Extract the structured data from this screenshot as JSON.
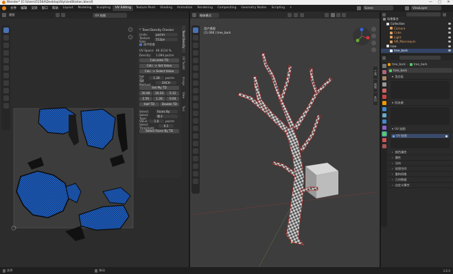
{
  "window": {
    "title": "Blender* [C:\\Users\\51564\\Desktop\\StylizedStation.blend]",
    "minimize": "—",
    "maximize": "□",
    "close": "✕"
  },
  "menu": [
    "文件",
    "编辑",
    "渲染",
    "窗口",
    "帮助"
  ],
  "workspace_tabs": [
    "Layout",
    "Modeling",
    "Sculpting",
    "UV Editing",
    "Texture Paint",
    "Shading",
    "Animation",
    "Rendering",
    "Compositing",
    "Geometry Nodes",
    "Scripting"
  ],
  "active_workspace": "UV Editing",
  "scene": "Scene",
  "view_layer": "ViewLayer",
  "uv_editor": {
    "header_mode": "视图",
    "image_label": "UV 贴图",
    "texel_panel": {
      "title": "Texel Density Checker",
      "units_label": "Units:",
      "units_value": "px/cm",
      "texture_size_label": "Texture Size:",
      "texture_size_value": "512px",
      "checkbox_label": "选中检查",
      "uv_space_label": "UV Space:",
      "uv_space_value": "46.3114 %",
      "density_label": "Density:",
      "density_value": "1.094 px/cm",
      "btn_calculate": "Calculate TD",
      "btn_calc_uv": "Calc -> Set Value",
      "btn_calc_select": "Calc -> Select Value",
      "set_td_label": "Set TD:",
      "set_td_value": "1.28",
      "set_td_unit": "px/cm",
      "set_method_label": "Set Method:",
      "set_method_value": "EACH",
      "btn_set_td": "Set My TD",
      "presets_row1": [
        "20.48",
        "10.24",
        "5.12"
      ],
      "presets_row2": [
        "2.56",
        "1.28",
        "0.64"
      ],
      "btn_half": "Half TD",
      "btn_double": "Double TD",
      "select_label": "Select:",
      "select_value": "Faces By",
      "select_type_label": "Select Type:",
      "select_type_value": "等于",
      "value_label": "Value:",
      "value_value": "1.0",
      "value_unit": "px/cm",
      "threshold_label": "Select Threshold:",
      "threshold_value": "0.1",
      "btn_select_by_td": "Select Faces By TD"
    },
    "side_tabs": [
      "Texel Density",
      "UV Toolkit",
      "Image",
      "View",
      "Tool"
    ]
  },
  "viewport": {
    "header_mode": "物体模式",
    "overlay_line1": "用户透视",
    "overlay_line2": "(1) 006 | tree_bark",
    "side_tabs": [
      "工具",
      "视图",
      "条目"
    ]
  },
  "outliner": {
    "title": "场景集合",
    "items": [
      {
        "label": "Collection",
        "indent": 1,
        "color": "#e0e0e0",
        "icon": "collection-icon"
      },
      {
        "label": "Camera",
        "indent": 2,
        "color": "#e0a060",
        "icon": "camera-icon"
      },
      {
        "label": "Cube",
        "indent": 2,
        "color": "#e0a060",
        "icon": "mesh-icon"
      },
      {
        "label": "Light",
        "indent": 2,
        "color": "#e0a060",
        "icon": "light-icon"
      },
      {
        "label": "SM_Mannequin",
        "indent": 2,
        "color": "#e0a060",
        "icon": "mesh-icon"
      },
      {
        "label": "tree",
        "indent": 1,
        "color": "#e0e0e0",
        "icon": "collection-icon"
      },
      {
        "label": "tree_bark",
        "indent": 2,
        "color": "#ffffff",
        "icon": "mesh-icon",
        "selected": true
      }
    ]
  },
  "properties": {
    "search_placeholder": "",
    "object_name": "tree_bark",
    "mesh_name": "tree_bark",
    "sections": [
      "顶点组",
      "形态键"
    ],
    "uv_section": "UV 贴图",
    "uv_item": "UV 贴图",
    "collapsed": [
      "颜色属性",
      "属性",
      "法向",
      "纹理空间",
      "重构网格",
      "几何数据",
      "自定义属性"
    ]
  },
  "status_bar": {
    "left": "选择",
    "mid": "移动",
    "right": "3.6.0"
  },
  "colors": {
    "accent": "#4a72b3",
    "uv_island": "#1f5fc0",
    "edge_red": "#b02020",
    "cube_gray": "#bcbcbc"
  }
}
